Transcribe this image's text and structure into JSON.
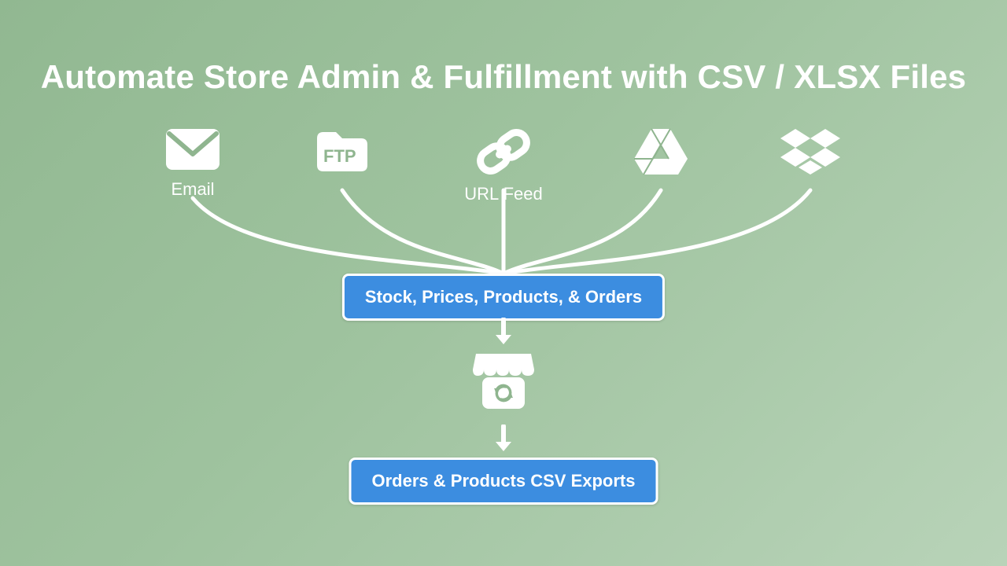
{
  "title": "Automate Store Admin & Fulfillment with CSV / XLSX Files",
  "sources": {
    "email": {
      "label": "Email"
    },
    "ftp": {
      "label": "FTP"
    },
    "url": {
      "label": "URL Feed"
    },
    "gdrive": {
      "label": ""
    },
    "dropbox": {
      "label": ""
    }
  },
  "box_imports": "Stock, Prices, Products, & Orders",
  "box_exports": "Orders & Products CSV Exports",
  "accent": "#3c8de0"
}
